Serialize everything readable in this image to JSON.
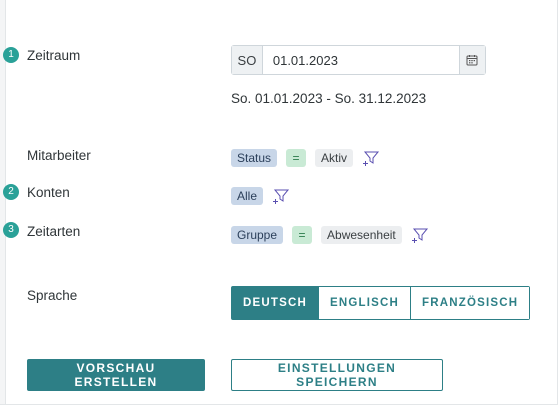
{
  "steps": {
    "zeitraum": "1",
    "konten": "2",
    "zeitarten": "3"
  },
  "labels": {
    "zeitraum": "Zeitraum",
    "mitarbeiter": "Mitarbeiter",
    "konten": "Konten",
    "zeitarten": "Zeitarten",
    "sprache": "Sprache"
  },
  "date": {
    "weekday": "SO",
    "value": "01.01.2023",
    "calendar_icon": "calendar-icon",
    "range_text": "So. 01.01.2023 - So. 31.12.2023"
  },
  "filters": {
    "mitarbeiter": {
      "field": "Status",
      "operator": "=",
      "value": "Aktiv",
      "icon": "filter-add-icon"
    },
    "konten": {
      "field": "Alle",
      "icon": "filter-add-icon"
    },
    "zeitarten": {
      "field": "Gruppe",
      "operator": "=",
      "value": "Abwesenheit",
      "icon": "filter-add-icon"
    }
  },
  "language": {
    "options": [
      "DEUTSCH",
      "ENGLISCH",
      "FRANZÖSISCH"
    ],
    "selected": "DEUTSCH"
  },
  "actions": {
    "preview": "VORSCHAU ERSTELLEN",
    "save": "EINSTELLUNGEN SPEICHERN"
  },
  "colors": {
    "accent": "#2d7f86",
    "step_badge": "#2aa198",
    "chip_field": "#c8d6e8",
    "chip_operator": "#c9ead5",
    "chip_value": "#eceef0"
  }
}
